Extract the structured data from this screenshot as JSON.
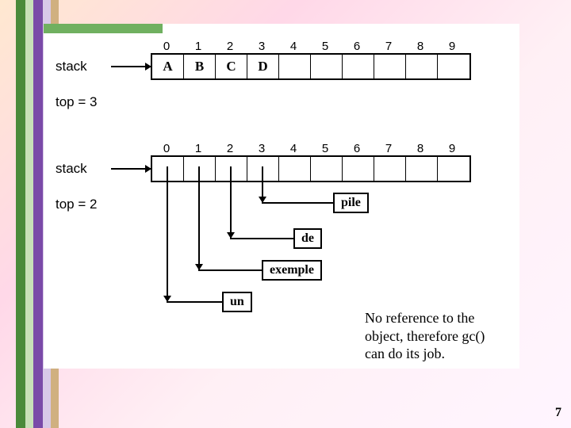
{
  "indices": [
    "0",
    "1",
    "2",
    "3",
    "4",
    "5",
    "6",
    "7",
    "8",
    "9"
  ],
  "group1": {
    "label": "stack",
    "cells": [
      "A",
      "B",
      "C",
      "D",
      "",
      "",
      "",
      "",
      "",
      ""
    ],
    "top": "top = 3",
    "marker_index": 3
  },
  "group2": {
    "label": "stack",
    "cells": [
      "",
      "",
      "",
      "",
      "",
      "",
      "",
      "",
      "",
      ""
    ],
    "top": "top = 2",
    "marker_index": 2
  },
  "refs": {
    "r3": "pile",
    "r2": "de",
    "r1": "exemple",
    "r0": "un"
  },
  "caption_l1": "No reference to the",
  "caption_l2": "object, therefore gc()",
  "caption_l3": "can do its job.",
  "page": "7"
}
